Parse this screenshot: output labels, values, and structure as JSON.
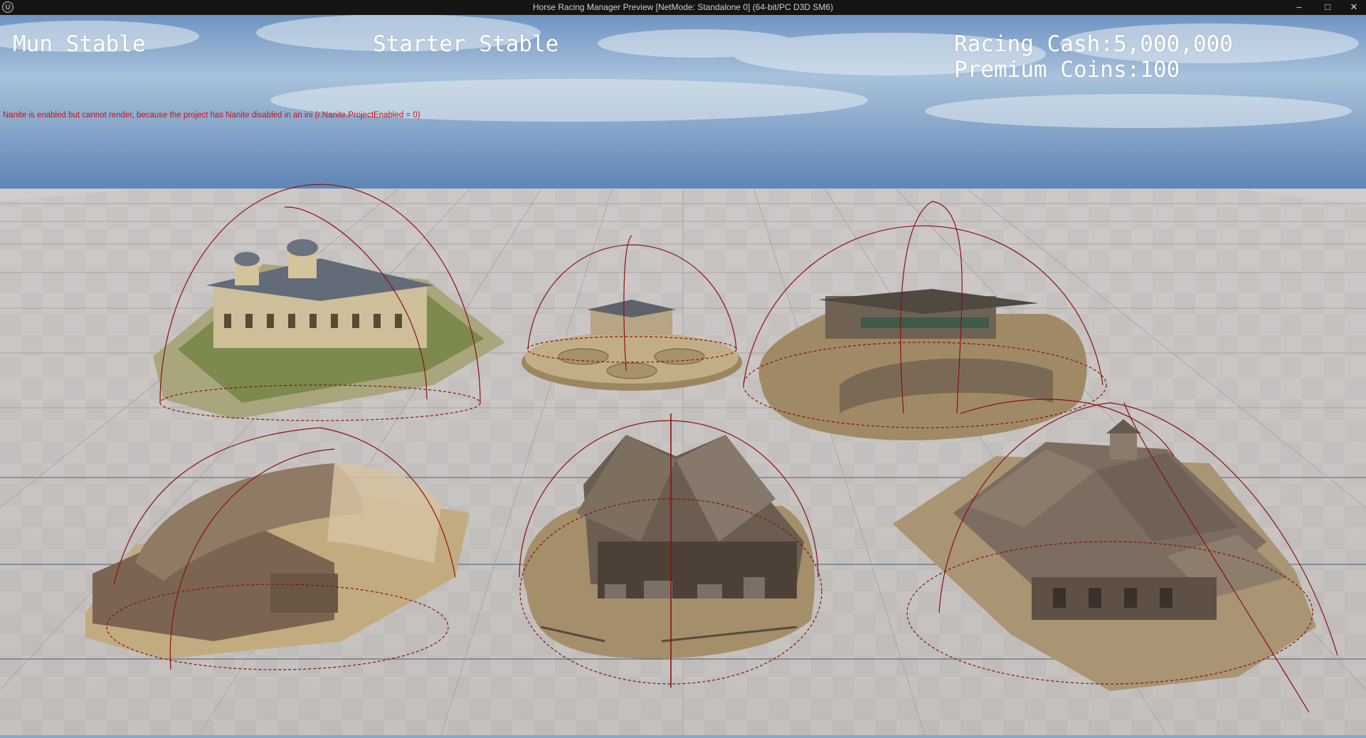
{
  "window": {
    "title": "Horse Racing Manager Preview [NetMode: Standalone 0]  (64-bit/PC D3D SM6)",
    "app_icon": "unreal-engine-icon",
    "minimize_glyph": "–",
    "maximize_glyph": "□",
    "close_glyph": "✕"
  },
  "hud": {
    "player_name": "Mun Stable",
    "stable_tier": "Starter Stable",
    "racing_cash_label": "Racing Cash:",
    "racing_cash_value": "5,000,000",
    "premium_coins_label": "Premium Coins:",
    "premium_coins_value": "100"
  },
  "debug": {
    "nanite_warning": "Nanite is enabled but cannot render, because the project has Nanite disabled in an ini (r.Nanite.ProjectEnabled = 0)"
  },
  "scene": {
    "sky_color": "#8fb0d0",
    "floor_color": "#bfbcba",
    "bounds_color": "#8b1010",
    "stables": [
      {
        "id": "palace-estate",
        "style": "ornate palace"
      },
      {
        "id": "round-paddock",
        "style": "circular arena"
      },
      {
        "id": "oval-grandstand",
        "style": "wooden grandstand"
      },
      {
        "id": "arched-barn",
        "style": "curved roof barn"
      },
      {
        "id": "starter-barn",
        "style": "old wooden barn"
      },
      {
        "id": "farmhouse",
        "style": "large farmhouse"
      }
    ]
  }
}
